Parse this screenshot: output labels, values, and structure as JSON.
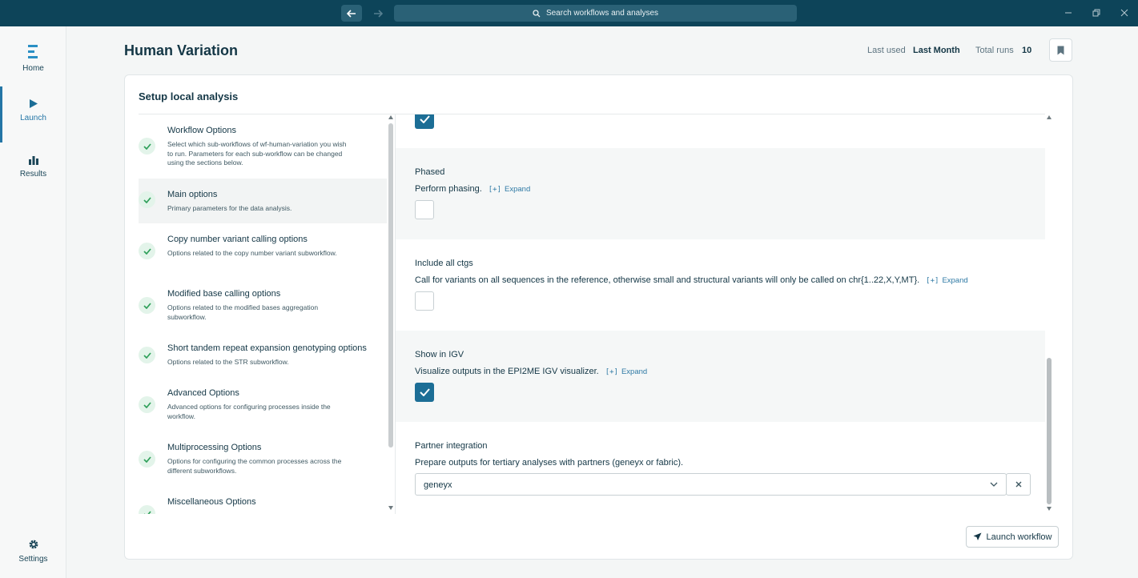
{
  "titlebar": {
    "search_placeholder": "Search workflows and analyses"
  },
  "sidebar": {
    "items": [
      {
        "label": "Home",
        "icon": "logo-icon"
      },
      {
        "label": "Launch",
        "icon": "play-icon"
      },
      {
        "label": "Results",
        "icon": "bar-chart-icon"
      }
    ],
    "settings_label": "Settings"
  },
  "header": {
    "title": "Human Variation",
    "last_used_label": "Last used",
    "last_used_value": "Last Month",
    "total_runs_label": "Total runs",
    "total_runs_value": "10"
  },
  "card": {
    "title": "Setup local analysis",
    "launch_label": "Launch workflow"
  },
  "steps": [
    {
      "title": "Workflow Options",
      "desc": "Select which sub-workflows of wf-human-variation you wish to run. Parameters for each sub-workflow can be changed using the sections below."
    },
    {
      "title": "Main options",
      "desc": "Primary parameters for the data analysis."
    },
    {
      "title": "Copy number variant calling options",
      "desc": "Options related to the copy number variant subworkflow."
    },
    {
      "title": "Modified base calling options",
      "desc": "Options related to the modified bases aggregation subworkflow."
    },
    {
      "title": "Short tandem repeat expansion genotyping options",
      "desc": "Options related to the STR subworkflow."
    },
    {
      "title": "Advanced Options",
      "desc": "Advanced options for configuring processes inside the workflow."
    },
    {
      "title": "Multiprocessing Options",
      "desc": "Options for configuring the common processes across the different subworkflows."
    },
    {
      "title": "Miscellaneous Options",
      "desc": ""
    }
  ],
  "params": {
    "expand_bracket": "[+]",
    "expand_label": "Expand",
    "phased": {
      "title": "Phased",
      "desc": "Perform phasing.",
      "checked": false
    },
    "include_all_ctgs": {
      "title": "Include all ctgs",
      "desc": "Call for variants on all sequences in the reference, otherwise small and structural variants will only be called on chr{1..22,X,Y,MT}.",
      "checked": false
    },
    "show_in_igv": {
      "title": "Show in IGV",
      "desc": "Visualize outputs in the EPI2ME IGV visualizer.",
      "checked": true
    },
    "partner_integration": {
      "title": "Partner integration",
      "desc": "Prepare outputs for tertiary analyses with partners (geneyx or fabric).",
      "value": "geneyx"
    }
  },
  "colors": {
    "titlebar": "#0d4459",
    "accent": "#1c6e96",
    "success": "#2fa05a"
  }
}
